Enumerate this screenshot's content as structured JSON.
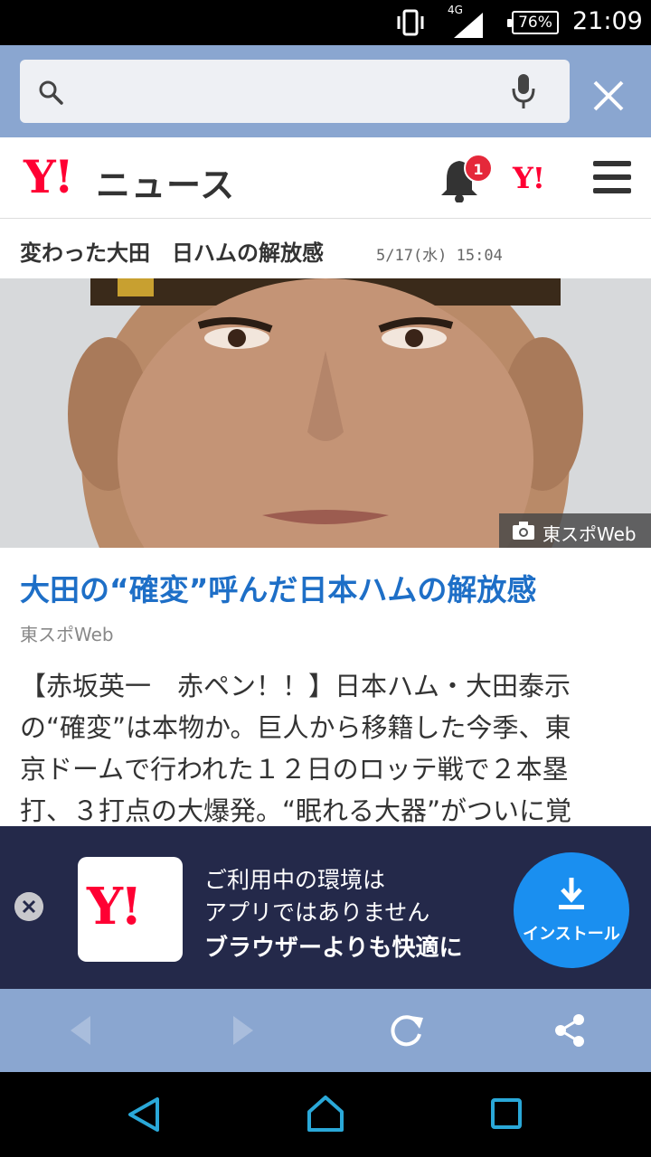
{
  "status_bar": {
    "network": "4G",
    "battery": "76%",
    "time": "21:09",
    "icons": [
      "vibrate-icon",
      "signal-icon",
      "battery-icon"
    ]
  },
  "search": {
    "placeholder": "",
    "icons": [
      "search-icon",
      "mic-icon",
      "close-icon"
    ]
  },
  "header": {
    "logo": "Y!",
    "title": "ニュース",
    "notification_count": "1",
    "yahoo_link": "Y!",
    "icons": [
      "bell-icon",
      "menu-icon"
    ]
  },
  "topic": {
    "title": "変わった大田　日ハムの解放感",
    "datetime": "5/17(水) 15:04"
  },
  "photo": {
    "credit": "東スポWeb"
  },
  "article": {
    "headline": "大田の“確変”呼んだ日本ハムの解放感",
    "source": "東スポWeb",
    "body_lines": [
      "【赤坂英一　赤ペン！！】日本ハム・大田泰示",
      "の“確変”は本物か。巨人から移籍した今季、東",
      "京ドームで行われた１２日のロッテ戦で２本塁",
      "打、３打点の大爆発。“眠れる大器”がついに覚"
    ]
  },
  "banner": {
    "app_logo": "Y!",
    "line1": "ご利用中の環境は",
    "line2": "アプリではありません",
    "line3": "ブラウザーよりも快適に",
    "install_label": "インストール"
  },
  "colors": {
    "brand_red": "#ff0033",
    "headline_blue": "#1e6fc7",
    "toolbar_blue": "#8aa6d0",
    "banner_navy": "#24294a",
    "install_blue": "#1a8ff0"
  }
}
